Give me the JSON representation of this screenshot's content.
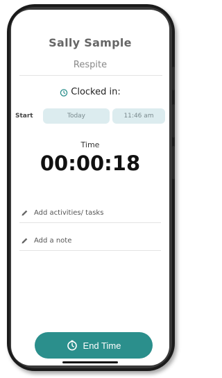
{
  "profile": {
    "name": "Sally Sample",
    "service": "Respite"
  },
  "status": {
    "label": "Clocked in:",
    "icon": "timer-icon",
    "accent": "#2b8f8c"
  },
  "start": {
    "label": "Start",
    "date": "Today",
    "time": "11:46 am"
  },
  "timer": {
    "label": "Time",
    "value": "00:00:18"
  },
  "actions": {
    "add_activities": "Add activities/ tasks",
    "add_note": "Add a note",
    "icon": "pencil-icon"
  },
  "footer": {
    "end_label": "End Time",
    "end_icon": "timer-icon",
    "button_color": "#2b8f8c"
  }
}
